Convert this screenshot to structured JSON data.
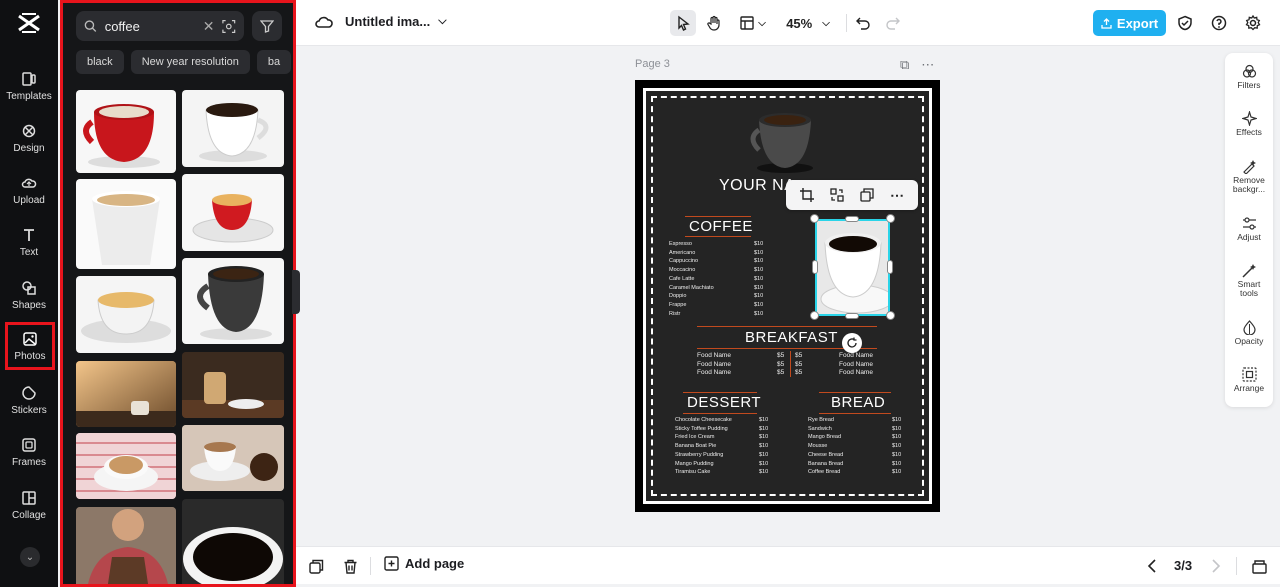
{
  "rail": {
    "items": [
      {
        "label": "Templates",
        "icon": "templates-icon"
      },
      {
        "label": "Design",
        "icon": "design-icon"
      },
      {
        "label": "Upload",
        "icon": "upload-icon"
      },
      {
        "label": "Text",
        "icon": "text-icon"
      },
      {
        "label": "Shapes",
        "icon": "shapes-icon"
      },
      {
        "label": "Photos",
        "icon": "photos-icon"
      },
      {
        "label": "Stickers",
        "icon": "stickers-icon"
      },
      {
        "label": "Frames",
        "icon": "frames-icon"
      },
      {
        "label": "Collage",
        "icon": "collage-icon"
      }
    ],
    "active": "Photos"
  },
  "panel": {
    "search_value": "coffee",
    "chips": [
      "black",
      "New year resolution",
      "ba"
    ]
  },
  "topbar": {
    "title": "Untitled ima...",
    "zoom": "45%",
    "export_label": "Export"
  },
  "canvas": {
    "page_label": "Page 3",
    "menu": {
      "name_heading": "YOUR NA",
      "coffee_heading": "COFFEE",
      "coffee_items": [
        "Espresso",
        "Americano",
        "Cappuccino",
        "Moccacino",
        "Cafe Latte",
        "Caramel Machiato",
        "Doppio",
        "Frappe",
        "Ristr"
      ],
      "coffee_prices": [
        "$10",
        "$10",
        "$10",
        "$10",
        "$10",
        "$10",
        "$10",
        "$10",
        "$10"
      ],
      "breakfast_heading": "BREAKFAST",
      "breakfast_left": [
        "Food Name",
        "Food Name",
        "Food Name"
      ],
      "breakfast_prices_a": [
        "$5",
        "$5",
        "$5"
      ],
      "breakfast_prices_b": [
        "$5",
        "$5",
        "$5"
      ],
      "breakfast_right": [
        "Food Name",
        "Food Name",
        "Food Name"
      ],
      "dessert_heading": "DESSERT",
      "dessert_items": [
        "Chocolate Cheesecake",
        "Sticky Toffee Pudding",
        "Fried Ice Cream",
        "Banana Boat Pie",
        "Strawberry Pudding",
        "Mango Pudding",
        "Tiramisu Cake"
      ],
      "dessert_prices": [
        "$10",
        "$10",
        "$10",
        "$10",
        "$10",
        "$10",
        "$10"
      ],
      "bread_heading": "BREAD",
      "bread_items": [
        "Rye Bread",
        "Sandwich",
        "Mango Bread",
        "Mousse",
        "Cheese Bread",
        "Banana Bread",
        "Coffee Bread"
      ],
      "bread_prices": [
        "$10",
        "$10",
        "$10",
        "$10",
        "$10",
        "$10",
        "$10"
      ]
    }
  },
  "right_tools": [
    {
      "label": "Filters",
      "icon": "filters-icon"
    },
    {
      "label": "Effects",
      "icon": "effects-icon"
    },
    {
      "label": "Remove backgr...",
      "icon": "remove-background-icon"
    },
    {
      "label": "Adjust",
      "icon": "adjust-icon"
    },
    {
      "label": "Smart tools",
      "icon": "smart-tools-icon"
    },
    {
      "label": "Opacity",
      "icon": "opacity-icon"
    },
    {
      "label": "Arrange",
      "icon": "arrange-icon"
    }
  ],
  "bottombar": {
    "add_page_label": "Add page",
    "pager": "3/3"
  },
  "colors": {
    "accent": "#1fb0f0",
    "highlight": "#e8141c",
    "selection": "#2ad4e8"
  }
}
